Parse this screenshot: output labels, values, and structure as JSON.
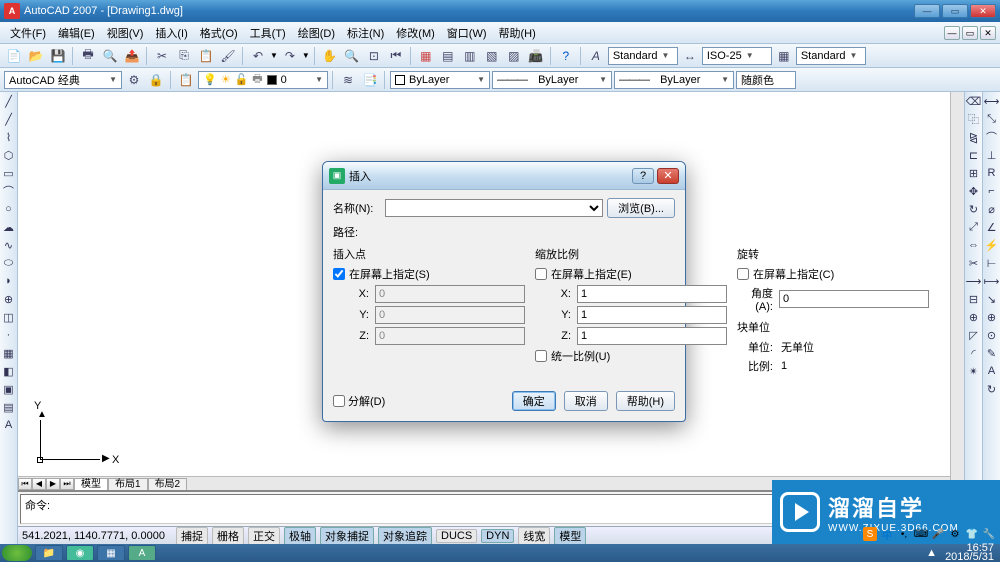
{
  "titlebar": {
    "app": "AutoCAD 2007",
    "doc": "[Drawing1.dwg]"
  },
  "menu": [
    "文件(F)",
    "编辑(E)",
    "视图(V)",
    "插入(I)",
    "格式(O)",
    "工具(T)",
    "绘图(D)",
    "标注(N)",
    "修改(M)",
    "窗口(W)",
    "帮助(H)"
  ],
  "toolbar1": {
    "style_combo": "Standard",
    "dim_combo": "ISO-25",
    "table_combo": "Standard"
  },
  "toolbar2": {
    "workspace": "AutoCAD 经典",
    "layer_state": "0",
    "linetype": "ByLayer",
    "lineweight": "ByLayer",
    "plot_style": "ByLayer",
    "color": "随颜色"
  },
  "canvas": {
    "x_label": "X",
    "y_label": "Y"
  },
  "tabs": [
    "模型",
    "布局1",
    "布局2"
  ],
  "cmd": {
    "prompt": "命令:"
  },
  "status": {
    "coords": "541.2021, 1140.7771, 0.0000",
    "buttons": [
      "捕捉",
      "栅格",
      "正交",
      "极轴",
      "对象捕捉",
      "对象追踪",
      "DUCS",
      "DYN",
      "线宽",
      "模型"
    ]
  },
  "dialog": {
    "title": "插入",
    "name_label": "名称(N):",
    "name_value": "",
    "browse": "浏览(B)...",
    "path_label": "路径:",
    "insert_point": {
      "group": "插入点",
      "specify": "在屏幕上指定(S)",
      "X": "0",
      "Y": "0",
      "Z": "0"
    },
    "scale": {
      "group": "缩放比例",
      "specify": "在屏幕上指定(E)",
      "X": "1",
      "Y": "1",
      "Z": "1",
      "uniform": "统一比例(U)"
    },
    "rotation": {
      "group": "旋转",
      "specify": "在屏幕上指定(C)",
      "angle_label": "角度(A):",
      "angle": "0"
    },
    "block_unit": {
      "group": "块单位",
      "unit_label": "单位:",
      "unit": "无单位",
      "factor_label": "比例:",
      "factor": "1"
    },
    "explode": "分解(D)",
    "ok": "确定",
    "cancel": "取消",
    "help": "帮助(H)"
  },
  "watermark": {
    "big": "溜溜自学",
    "small": "WWW.ZIXUE.3D66.COM"
  },
  "input_tray": {
    "s_icon": "S",
    "zhong": "中"
  },
  "clock": {
    "time": "16:57",
    "date": "2018/5/31"
  }
}
